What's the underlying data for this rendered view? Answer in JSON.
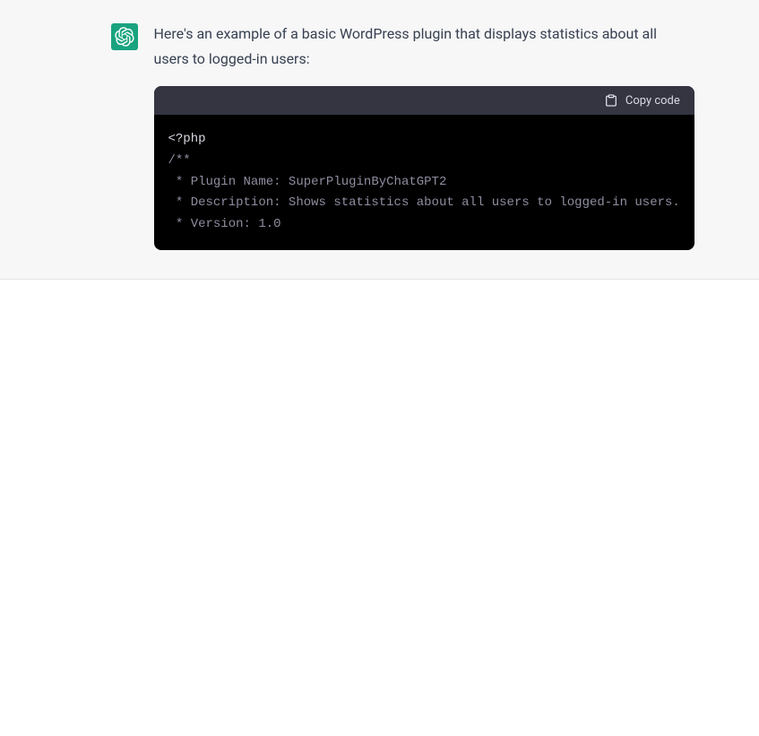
{
  "message": {
    "intro": "Here's an example of a basic WordPress plugin that displays statistics about all users to logged-in users:"
  },
  "code": {
    "copy_label": "Copy code",
    "line1": "<?php",
    "line2": "/**",
    "line3": " * Plugin Name: SuperPluginByChatGPT2",
    "line4": " * Description: Shows statistics about all users to logged-in users.",
    "line5": " * Version: 1.0"
  }
}
